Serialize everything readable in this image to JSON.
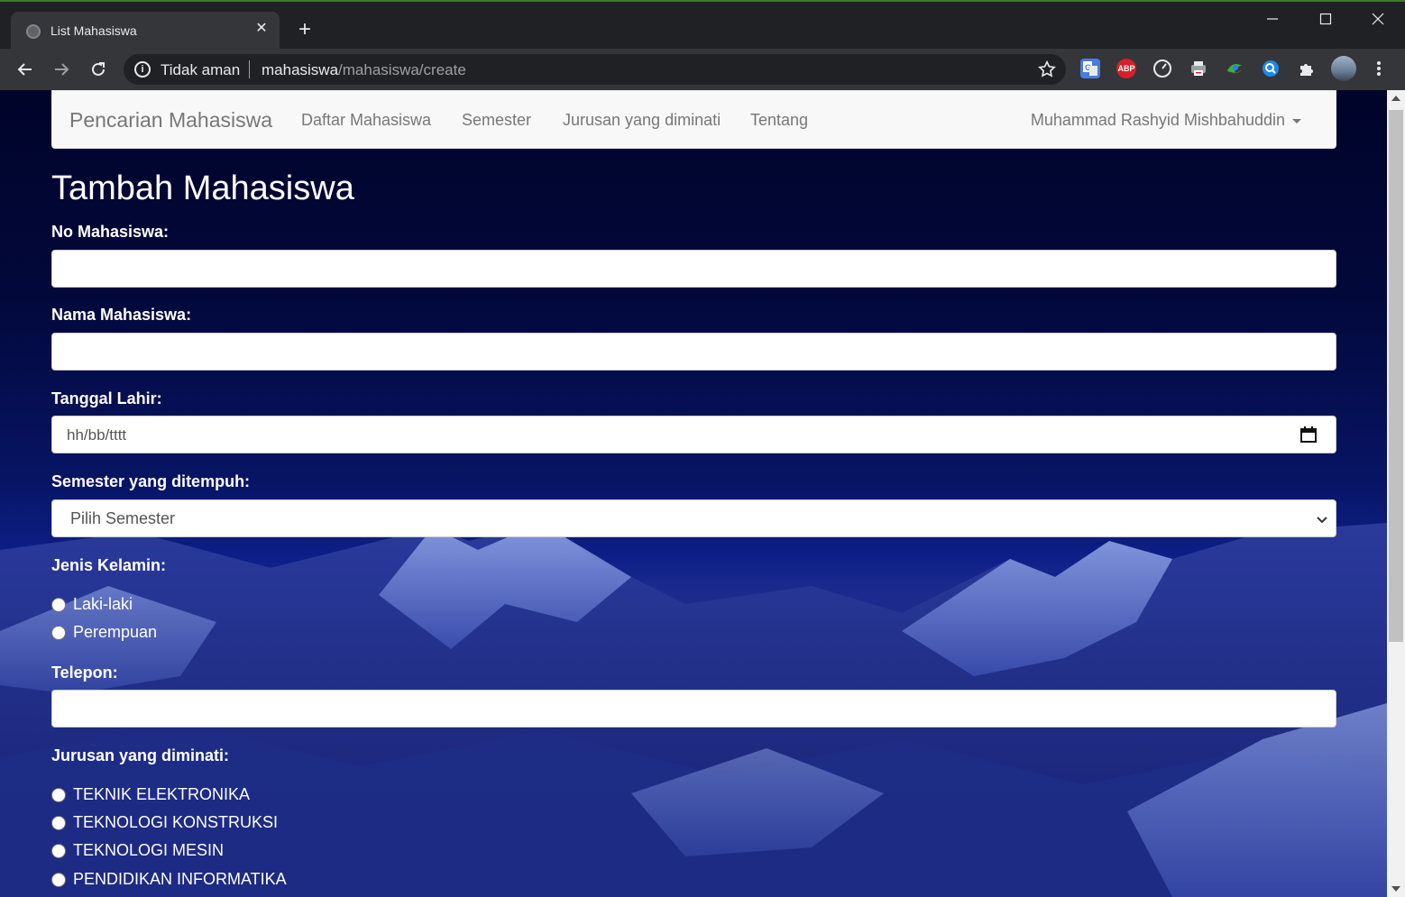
{
  "browser": {
    "tab_title": "List Mahasiswa",
    "tab_close": "✕",
    "new_tab": "+",
    "security_label": "Tidak aman",
    "url_host": "mahasiswa",
    "url_path": "/mahasiswa/create",
    "extensions": [
      "google-translate-icon",
      "adblock-plus-icon",
      "speedometer-icon",
      "printer-icon",
      "color-wheel-icon",
      "search-lens-icon",
      "puzzle-icon",
      "profile-avatar"
    ],
    "abp_label": "ABP"
  },
  "navbar": {
    "brand": "Pencarian Mahasiswa",
    "links": [
      "Daftar Mahasiswa",
      "Semester",
      "Jurusan yang diminati",
      "Tentang"
    ],
    "user": "Muhammad Rashyid Mishbahuddin"
  },
  "form": {
    "title": "Tambah Mahasiswa",
    "no_label": "No Mahasiswa:",
    "nama_label": "Nama Mahasiswa:",
    "tanggal_label": "Tanggal Lahir:",
    "tanggal_placeholder": "hh/bb/tttt",
    "semester_label": "Semester yang ditempuh:",
    "semester_selected": "Pilih Semester",
    "gender_label": "Jenis Kelamin:",
    "gender_options": [
      "Laki-laki",
      "Perempuan"
    ],
    "telepon_label": "Telepon:",
    "jurusan_label": "Jurusan yang diminati:",
    "jurusan_options": [
      "TEKNIK ELEKTRONIKA",
      "TEKNOLOGI KONSTRUKSI",
      "TEKNOLOGI MESIN",
      "PENDIDIKAN INFORMATIKA"
    ]
  },
  "colors": {
    "navbar_bg": "#f8f8f8",
    "chrome_dark": "#202124",
    "chrome_toolbar": "#35363a",
    "sky": "#02083a"
  }
}
